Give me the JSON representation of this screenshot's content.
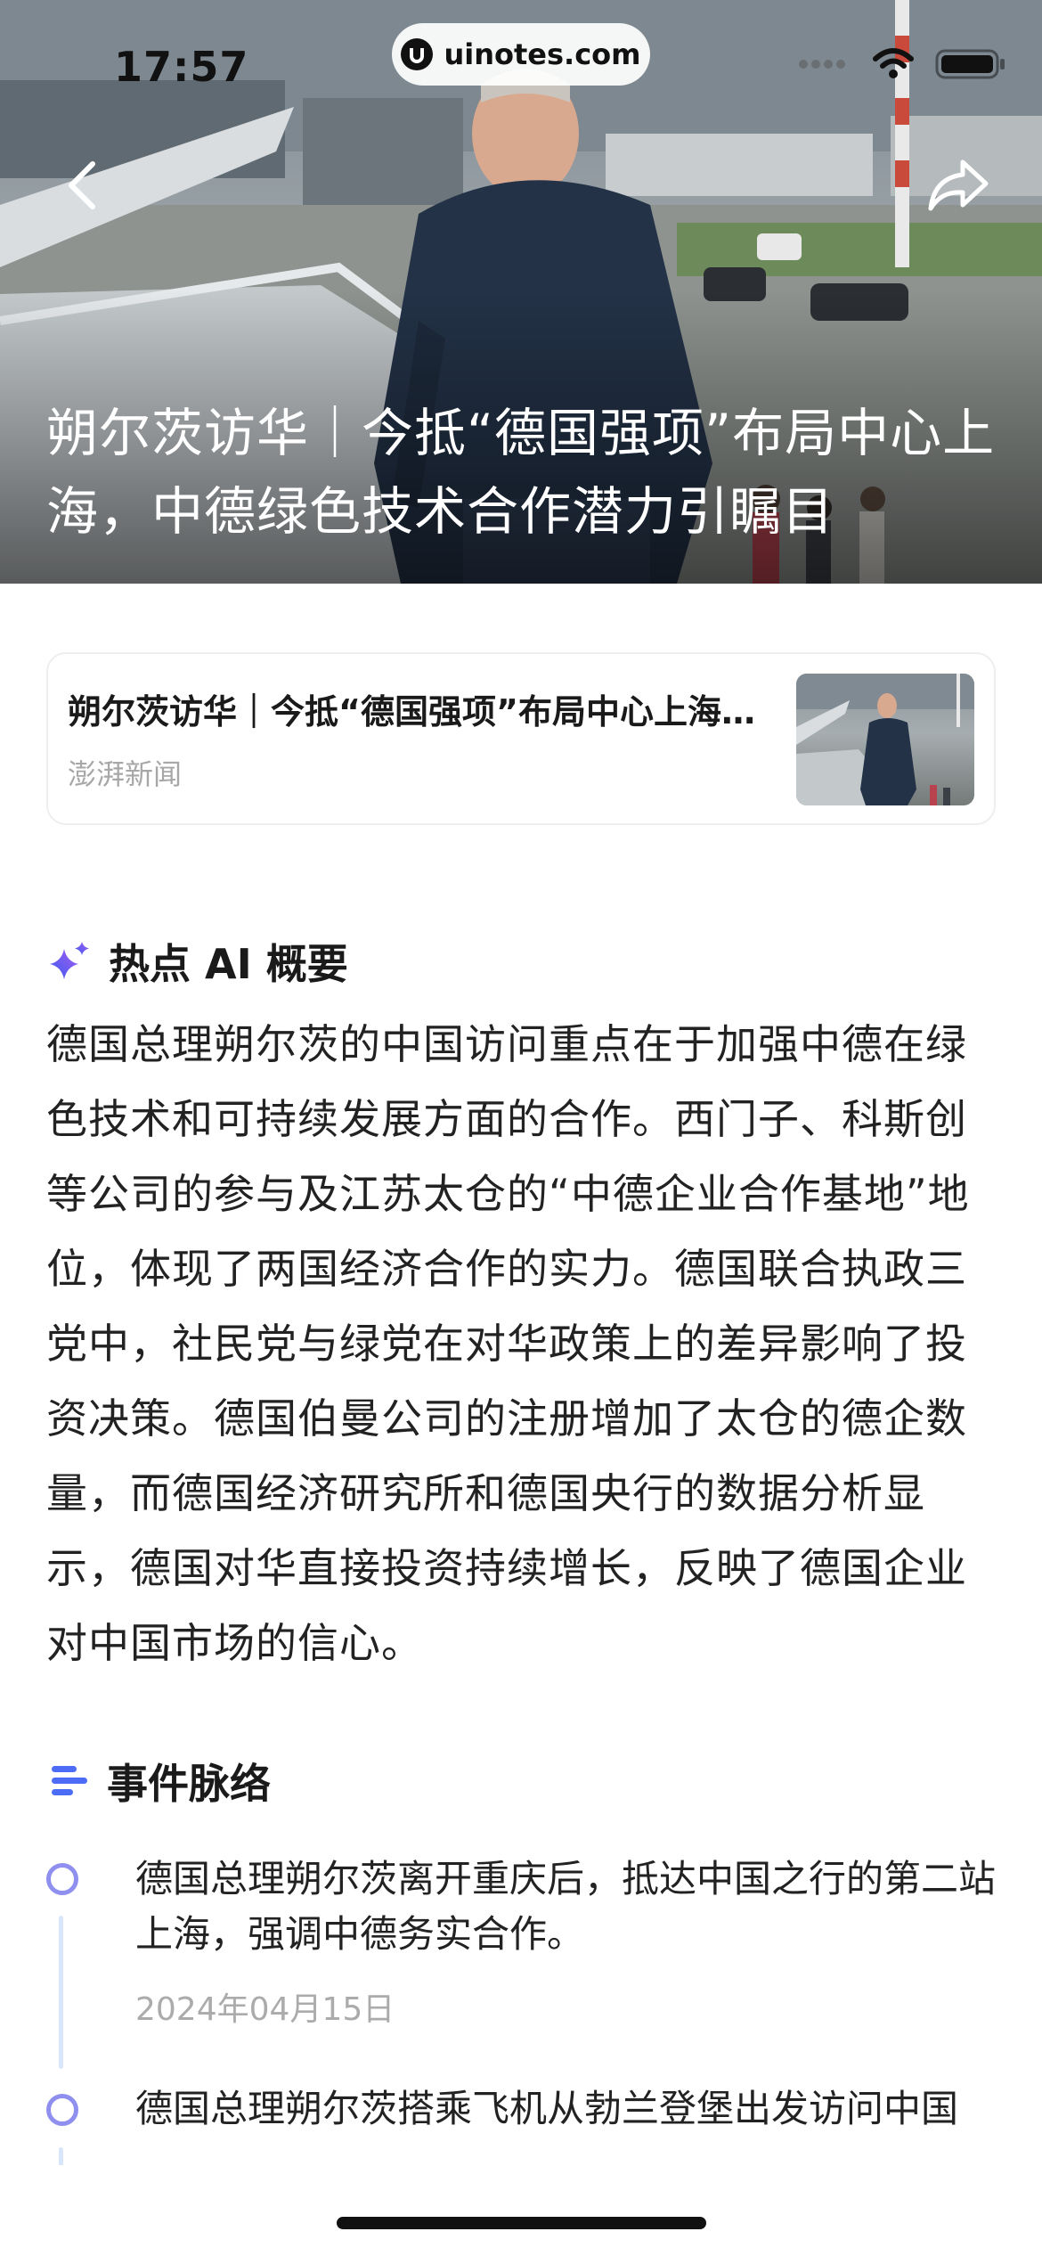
{
  "status_bar": {
    "time": "17:57",
    "url": "uinotes.com",
    "icons": [
      "signal-icon",
      "wifi-icon",
      "battery-icon"
    ]
  },
  "hero": {
    "title": "朔尔茨访华｜今抵“德国强项”布局中心上海，中德绿色技术合作潜力引瞩目",
    "back_icon": "chevron-left-icon",
    "share_icon": "share-icon"
  },
  "article_card": {
    "title": "朔尔茨访华｜今抵“德国强项”布局中心上海，中德绿色技术合作潜力引瞩目",
    "source": "澎湃新闻"
  },
  "ai_summary": {
    "icon": "sparkle-icon",
    "heading": "热点 AI 概要",
    "body": "德国总理朔尔茨的中国访问重点在于加强中德在绿色技术和可持续发展方面的合作。西门子、科斯创等公司的参与及江苏太仓的“中德企业合作基地”地位，体现了两国经济合作的实力。德国联合执政三党中，社民党与绿党在对华政策上的差异影响了投资决策。德国伯曼公司的注册增加了太仓的德企数量，而德国经济研究所和德国央行的数据分析显示，德国对华直接投资持续增长，反映了德国企业对中国市场的信心。"
  },
  "timeline": {
    "icon": "list-icon",
    "heading": "事件脉络",
    "events": [
      {
        "text": "德国总理朔尔茨离开重庆后，抵达中国之行的第二站上海，强调中德务实合作。",
        "date": "2024年04月15日"
      },
      {
        "text": "德国总理朔尔茨搭乘飞机从勃兰登堡出发访问中国",
        "date": ""
      }
    ]
  },
  "colors": {
    "accent_purple": "#8f8ff0",
    "sparkle_blue": "#4d6cf5",
    "timeline_line": "#d8e6fb",
    "muted_text": "#a7a7a7"
  }
}
